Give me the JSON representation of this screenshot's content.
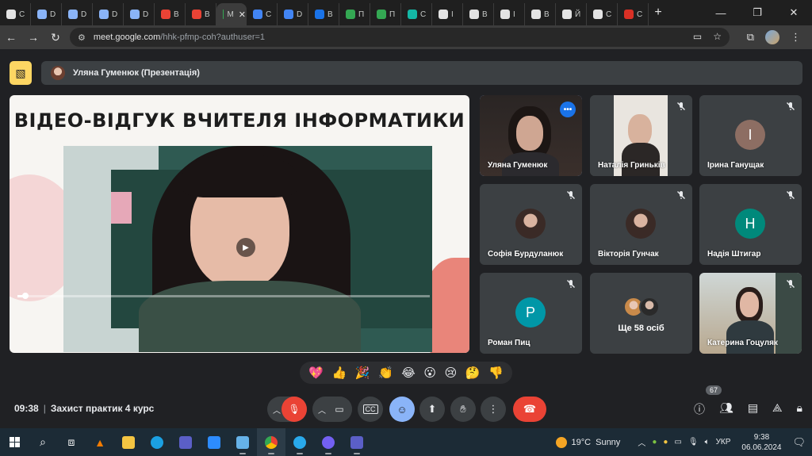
{
  "browser": {
    "tabs": [
      {
        "label": "C",
        "color": "#e3e3e3"
      },
      {
        "label": "D",
        "color": "#8ab4f8"
      },
      {
        "label": "D",
        "color": "#8ab4f8"
      },
      {
        "label": "D",
        "color": "#8ab4f8"
      },
      {
        "label": "D",
        "color": "#8ab4f8"
      },
      {
        "label": "B",
        "color": "#ea4335"
      },
      {
        "label": "B",
        "color": "#ea4335"
      },
      {
        "label": "M",
        "color": "#34a853"
      },
      {
        "label": "C",
        "color": "#4285f4"
      },
      {
        "label": "D",
        "color": "#4285f4"
      },
      {
        "label": "B",
        "color": "#1a73e8"
      },
      {
        "label": "П",
        "color": "#34a853"
      },
      {
        "label": "П",
        "color": "#34a853"
      },
      {
        "label": "C",
        "color": "#14b8a6"
      },
      {
        "label": "I",
        "color": "#e3e3e3"
      },
      {
        "label": "B",
        "color": "#e3e3e3"
      },
      {
        "label": "I",
        "color": "#e3e3e3"
      },
      {
        "label": "B",
        "color": "#e3e3e3"
      },
      {
        "label": "Й",
        "color": "#e3e3e3"
      },
      {
        "label": "C",
        "color": "#e3e3e3"
      },
      {
        "label": "C",
        "color": "#d93025"
      }
    ],
    "active_tab_index": 7,
    "close_glyph": "✕",
    "new_tab_glyph": "+",
    "url_domain": "meet.google.com",
    "url_path": "/hhk-pfmp-coh?authuser=1"
  },
  "meet": {
    "presenter_label": "Уляна Гуменюк (Презентація)",
    "main_video_title": "ВІДЕО-ВІДГУК ВЧИТЕЛЯ ІНФОРМАТИКИ",
    "video_progress": 0.02,
    "participants": [
      {
        "name": "Уляна Гуменюк",
        "type": "video",
        "active": true
      },
      {
        "name": "Наталія Гринькiв",
        "type": "video",
        "muted": true
      },
      {
        "name": "Ірина Ганущак",
        "type": "letter",
        "letter": "I",
        "color": "#8d6e63",
        "muted": true
      },
      {
        "name": "Софія Бурдуланюк",
        "type": "photo",
        "muted": true
      },
      {
        "name": "Вікторія Гунчак",
        "type": "photo",
        "muted": true
      },
      {
        "name": "Надія Штигар",
        "type": "letter",
        "letter": "H",
        "color": "#00897b",
        "muted": true
      },
      {
        "name": "Роман Пиц",
        "type": "letter",
        "letter": "P",
        "color": "#0097a7",
        "muted": true
      },
      {
        "name": "Ще 58 осіб",
        "type": "more"
      },
      {
        "name": "Катерина Гоцуляк",
        "type": "video",
        "muted": true
      }
    ],
    "reactions": [
      "💖",
      "👍",
      "🎉",
      "👏",
      "😂",
      "😮",
      "😢",
      "🤔",
      "👎"
    ],
    "meeting_time": "09:38",
    "meeting_title": "Захист практик 4 курс",
    "participant_count": "67"
  },
  "taskbar": {
    "weather_temp": "19°C",
    "weather_desc": "Sunny",
    "lang": "УКР",
    "time": "9:38",
    "date": "06.06.2024"
  }
}
